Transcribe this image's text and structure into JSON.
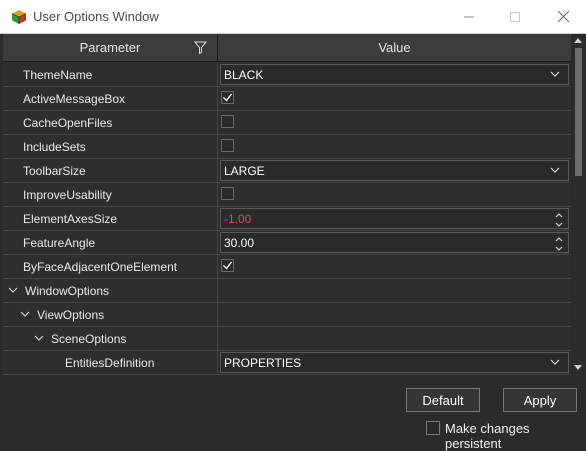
{
  "window": {
    "title": "User Options Window",
    "buttons": {
      "minimize": "—",
      "maximize": "□",
      "close": "✕"
    }
  },
  "grid": {
    "headers": {
      "parameter": "Parameter",
      "value": "Value"
    },
    "rows": [
      {
        "name": "ThemeName",
        "type": "combo",
        "value": "BLACK"
      },
      {
        "name": "ActiveMessageBox",
        "type": "checkbox",
        "checked": true
      },
      {
        "name": "CacheOpenFiles",
        "type": "checkbox",
        "checked": false
      },
      {
        "name": "IncludeSets",
        "type": "checkbox",
        "checked": false
      },
      {
        "name": "ToolbarSize",
        "type": "combo",
        "value": "LARGE"
      },
      {
        "name": "ImproveUsability",
        "type": "checkbox",
        "checked": false
      },
      {
        "name": "ElementAxesSize",
        "type": "numeric",
        "value": "-1.00",
        "color": "#e0454f"
      },
      {
        "name": "FeatureAngle",
        "type": "numeric",
        "value": "30.00"
      },
      {
        "name": "ByFaceAdjacentOneElement",
        "type": "checkbox",
        "checked": true
      },
      {
        "name": "WindowOptions",
        "type": "group",
        "expanded": true
      },
      {
        "name": "ViewOptions",
        "type": "group",
        "expanded": true
      },
      {
        "name": "SceneOptions",
        "type": "group",
        "expanded": true
      },
      {
        "name": "EntitiesDefinition",
        "type": "combo",
        "value": "PROPERTIES"
      }
    ]
  },
  "footer": {
    "default_label": "Default",
    "apply_label": "Apply",
    "persist_label": "Make changes persistent",
    "persist_checked": false
  },
  "colors": {
    "accent_negative": "#e0454f",
    "background": "#2b2b2b"
  }
}
